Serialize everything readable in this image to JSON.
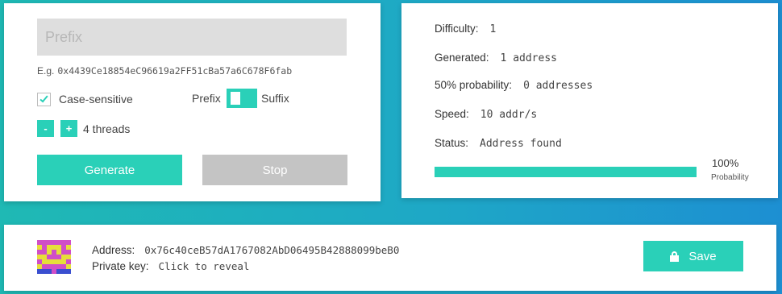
{
  "input": {
    "prefix_placeholder": "Prefix",
    "prefix_value": "",
    "example_label": "E.g.",
    "example_value": "0x4439Ce18854eC96619a2FF51cBa57a6C678F6fab",
    "case_sensitive_label": "Case-sensitive",
    "case_sensitive_checked": true,
    "toggle_left_label": "Prefix",
    "toggle_right_label": "Suffix",
    "toggle_selected": "Prefix",
    "minus_label": "-",
    "plus_label": "+",
    "threads_text": "4 threads",
    "generate_label": "Generate",
    "stop_label": "Stop"
  },
  "stats": {
    "difficulty_label": "Difficulty:",
    "difficulty_value": "1",
    "generated_label": "Generated:",
    "generated_value": "1 address",
    "probability50_label": "50% probability:",
    "probability50_value": "0 addresses",
    "speed_label": "Speed:",
    "speed_value": "10 addr/s",
    "status_label": "Status:",
    "status_value": "Address found",
    "probability_percent": "100%",
    "probability_caption": "Probability",
    "probability_fraction": 1.0
  },
  "result": {
    "address_label": "Address:",
    "address_value": "0x76c40ceB57dA1767082AbD06495B42888099beB0",
    "private_key_label": "Private key:",
    "private_key_value": "Click to reveal",
    "save_label": "Save"
  },
  "colors": {
    "accent": "#2ad0b8",
    "disabled_button": "#c4c4c4",
    "background_start": "#1fb9b4",
    "background_end": "#1d8fd2"
  },
  "icons": {
    "checkbox": "check-icon",
    "save": "lock-icon",
    "avatar": "identicon"
  }
}
